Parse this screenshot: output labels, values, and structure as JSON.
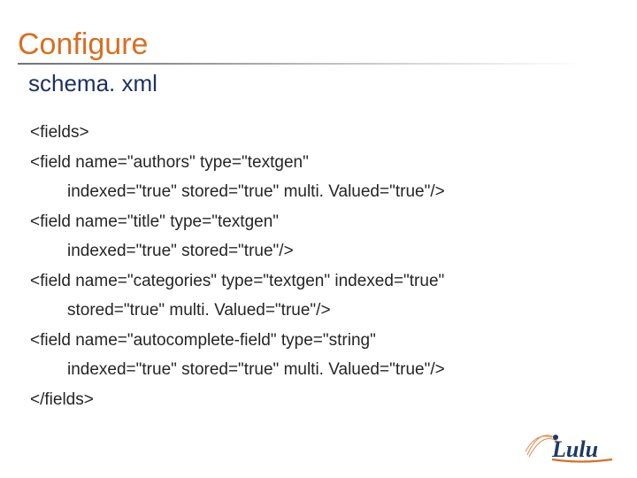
{
  "title": "Configure",
  "subtitle": "schema. xml",
  "lines": [
    {
      "text": "<fields>",
      "indent": false
    },
    {
      "text": "<field name=\"authors\" type=\"textgen\"",
      "indent": false
    },
    {
      "text": "indexed=\"true\" stored=\"true\" multi. Valued=\"true\"/>",
      "indent": true
    },
    {
      "text": "<field name=\"title\" type=\"textgen\"",
      "indent": false
    },
    {
      "text": "indexed=\"true\" stored=\"true\"/>",
      "indent": true
    },
    {
      "text": "<field name=\"categories\" type=\"textgen\" indexed=\"true\"",
      "indent": false
    },
    {
      "text": "stored=\"true\" multi. Valued=\"true\"/>",
      "indent": true
    },
    {
      "text": "<field name=\"autocomplete-field\" type=\"string\"",
      "indent": false
    },
    {
      "text": "indexed=\"true\" stored=\"true\" multi. Valued=\"true\"/>",
      "indent": true
    },
    {
      "text": "</fields>",
      "indent": false
    }
  ],
  "logo_text": "Lulu"
}
